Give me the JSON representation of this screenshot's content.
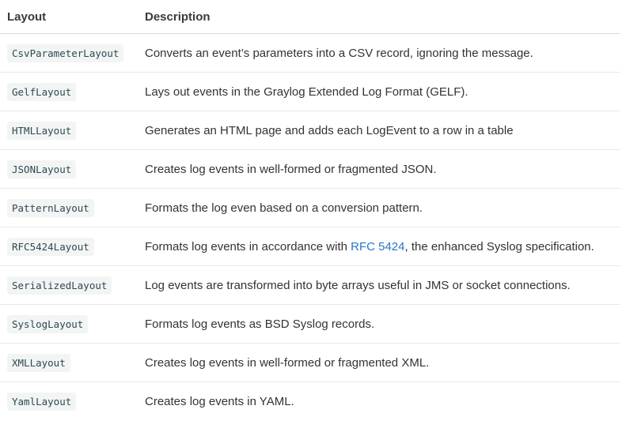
{
  "headers": {
    "layout": "Layout",
    "description": "Description"
  },
  "rows": [
    {
      "name": "CsvParameterLayout",
      "description": "Converts an event’s parameters into a CSV record, ignoring the message."
    },
    {
      "name": "GelfLayout",
      "description": "Lays out events in the Graylog Extended Log Format (GELF)."
    },
    {
      "name": "HTMLLayout",
      "description": "Generates an HTML page and adds each LogEvent to a row in a table"
    },
    {
      "name": "JSONLayout",
      "description": "Creates log events in well-formed or fragmented JSON."
    },
    {
      "name": "PatternLayout",
      "description": "Formats the log even based on a conversion pattern."
    },
    {
      "name": "RFC5424Layout",
      "description_before": "Formats log events in accordance with ",
      "description_link": "RFC 5424",
      "description_after": ", the enhanced Syslog specification."
    },
    {
      "name": "SerializedLayout",
      "description": "Log events are transformed into byte arrays useful in JMS or socket connections."
    },
    {
      "name": "SyslogLayout",
      "description": "Formats log events as BSD Syslog records."
    },
    {
      "name": "XMLLayout",
      "description": "Creates log events in well-formed or fragmented XML."
    },
    {
      "name": "YamlLayout",
      "description": "Creates log events in YAML."
    }
  ]
}
